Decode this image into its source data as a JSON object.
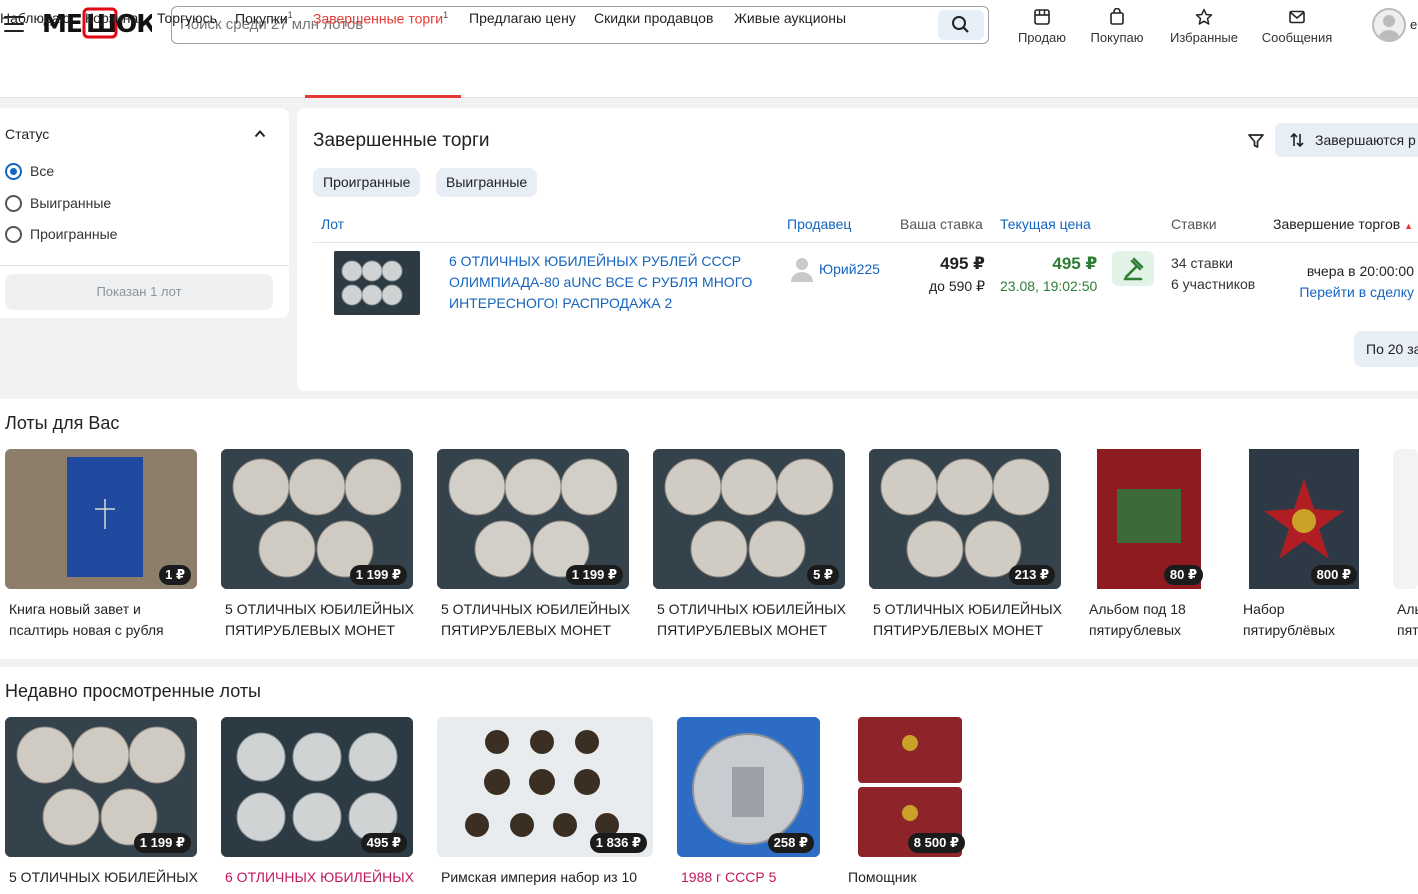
{
  "header": {
    "logo": "МЕШОК",
    "search_placeholder": "Поиск среди 27 млн лотов",
    "nav": [
      {
        "label": "Продаю",
        "icon": "storefront-icon"
      },
      {
        "label": "Покупаю",
        "icon": "shopping-bag-icon"
      },
      {
        "label": "Избранные",
        "icon": "star-icon"
      },
      {
        "label": "Сообщения",
        "icon": "mail-icon"
      }
    ],
    "user_initial": "е"
  },
  "tabs": [
    {
      "label": "Наблюдаю",
      "sup": ""
    },
    {
      "label": "Корзина",
      "sup": ""
    },
    {
      "label": "Торгуюсь",
      "sup": ""
    },
    {
      "label": "Покупки",
      "sup": "1"
    },
    {
      "label": "Завершенные торги",
      "sup": "1",
      "active": true
    },
    {
      "label": "Предлагаю цену",
      "sup": ""
    },
    {
      "label": "Скидки продавцов",
      "sup": ""
    },
    {
      "label": "Живые аукционы",
      "sup": ""
    }
  ],
  "sidebar": {
    "title": "Статус",
    "options": [
      {
        "label": "Все",
        "selected": true
      },
      {
        "label": "Выигранные",
        "selected": false
      },
      {
        "label": "Проигранные",
        "selected": false
      }
    ],
    "shown_label": "Показан 1 лот"
  },
  "main": {
    "title": "Завершенные торги",
    "sort_label": "Завершаются р",
    "chips": [
      "Проигранные",
      "Выигранные"
    ],
    "columns": {
      "lot": "Лот",
      "seller": "Продавец",
      "your_bid": "Ваша ставка",
      "current_price": "Текущая цена",
      "bids": "Ставки",
      "end": "Завершение торгов"
    },
    "lot": {
      "title": "6 ОТЛИЧНЫХ ЮБИЛЕЙНЫХ РУБЛЕЙ СССР ОЛИМПИАДА-80 aUNC ВСЕ С РУБЛЯ МНОГО ИНТЕРЕСНОГО! РАСПРОДАЖА 2",
      "seller": "Юрий225",
      "your_bid": "495 ₽",
      "your_bid_max": "до 590 ₽",
      "current_price": "495 ₽",
      "current_time": "23.08, 19:02:50",
      "bids_count": "34 ставки",
      "participants": "6 участников",
      "end_time": "вчера в 20:00:00",
      "deal_link": "Перейти в сделку"
    },
    "per_page": "По 20 за"
  },
  "recommended": {
    "title": "Лоты для Вас",
    "items": [
      {
        "title": "Книга новый завет и псалтирь новая с рубля",
        "price": "1 ₽"
      },
      {
        "title": "5 ОТЛИЧНЫХ ЮБИЛЕЙНЫХ ПЯТИРУБЛЕВЫХ МОНЕТ",
        "price": "1 199 ₽"
      },
      {
        "title": "5 ОТЛИЧНЫХ ЮБИЛЕЙНЫХ ПЯТИРУБЛЕВЫХ МОНЕТ",
        "price": "1 199 ₽"
      },
      {
        "title": "5 ОТЛИЧНЫХ ЮБИЛЕЙНЫХ ПЯТИРУБЛЕВЫХ МОНЕТ",
        "price": "5 ₽"
      },
      {
        "title": "5 ОТЛИЧНЫХ ЮБИЛЕЙНЫХ ПЯТИРУБЛЕВЫХ МОНЕТ",
        "price": "213 ₽"
      },
      {
        "title": "Альбом под 18 пятирублевых",
        "price": "80 ₽"
      },
      {
        "title": "Набор пятирублёвых",
        "price": "800 ₽"
      },
      {
        "title": "Аль пят",
        "price": ""
      }
    ]
  },
  "recent": {
    "title": "Недавно просмотренные лоты",
    "items": [
      {
        "title": "5 ОТЛИЧНЫХ ЮБИЛЕЙНЫХ",
        "price": "1 199 ₽"
      },
      {
        "title": "6 ОТЛИЧНЫХ ЮБИЛЕЙНЫХ",
        "price": "495 ₽"
      },
      {
        "title": "Римская империя набор из 10",
        "price": "1 836 ₽"
      },
      {
        "title": "1988 г СССР 5",
        "price": "258 ₽"
      },
      {
        "title": "Помощник",
        "price": "8 500 ₽"
      }
    ]
  },
  "colors": {
    "accent": "#e53935",
    "link": "#1565c0",
    "price_green": "#2e7d32"
  }
}
